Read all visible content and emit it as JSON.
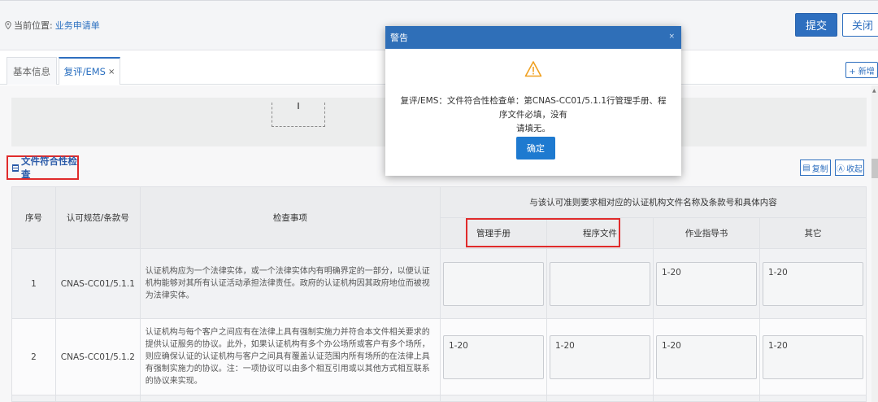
{
  "header": {
    "location_label": "当前位置:",
    "location_link": "业务申请单",
    "submit_label": "提交",
    "close_label": "关闭"
  },
  "tabs": [
    {
      "label": "基本信息"
    },
    {
      "label": "复评/EMS",
      "close": "×"
    }
  ],
  "new_button": "+ 新增",
  "section": {
    "title": "文件符合性检查",
    "copy_label": "复制",
    "fold_label": "收起"
  },
  "table": {
    "headers": {
      "seq": "序号",
      "clause": "认可规范/条款号",
      "item": "检查事项",
      "group": "与该认可准则要求相对应的认证机构文件名称及条款号和具体内容",
      "manual": "管理手册",
      "procedure": "程序文件",
      "instruction": "作业指导书",
      "other": "其它"
    },
    "rows": [
      {
        "seq": "1",
        "clause": "CNAS-CC01/5.1.1",
        "desc": "认证机构应为一个法律实体，或一个法律实体内有明确界定的一部分，以便认证机构能够对其所有认证活动承担法律责任。政府的认证机构因其政府地位而被视为法律实体。",
        "manual": "",
        "procedure": "",
        "instruction": "1-20",
        "other": "1-20"
      },
      {
        "seq": "2",
        "clause": "CNAS-CC01/5.1.2",
        "desc": "认证机构与每个客户之间应有在法律上具有强制实施力并符合本文件相关要求的提供认证服务的协议。此外，如果认证机构有多个办公场所或客户有多个场所，则应确保认证的认证机构与客户之间具有覆盖认证范围内所有场所的在法律上具有强制实施力的协议。注：一项协议可以由多个相互引用或以其他方式相互联系的协议来实现。",
        "manual": "1-20",
        "procedure": "1-20",
        "instruction": "1-20",
        "other": "1-20"
      }
    ]
  },
  "modal": {
    "title": "警告",
    "close": "×",
    "message_line1": "复评/EMS：文件符合性检查单：第CNAS-CC01/5.1.1行管理手册、程序文件必填，没有",
    "message_line2": "请填无。",
    "ok_label": "确定"
  },
  "colors": {
    "primary": "#2e6fbf",
    "highlight_red": "#e02b2b",
    "warning_orange": "#f0a020"
  }
}
